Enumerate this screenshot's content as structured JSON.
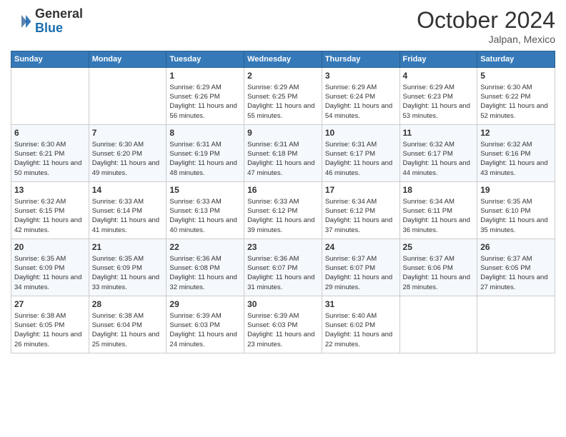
{
  "header": {
    "logo_line1": "General",
    "logo_line2": "Blue",
    "month_title": "October 2024",
    "location": "Jalpan, Mexico"
  },
  "days_of_week": [
    "Sunday",
    "Monday",
    "Tuesday",
    "Wednesday",
    "Thursday",
    "Friday",
    "Saturday"
  ],
  "weeks": [
    [
      {
        "day": "",
        "content": ""
      },
      {
        "day": "",
        "content": ""
      },
      {
        "day": "1",
        "content": "Sunrise: 6:29 AM\nSunset: 6:26 PM\nDaylight: 11 hours and 56 minutes."
      },
      {
        "day": "2",
        "content": "Sunrise: 6:29 AM\nSunset: 6:25 PM\nDaylight: 11 hours and 55 minutes."
      },
      {
        "day": "3",
        "content": "Sunrise: 6:29 AM\nSunset: 6:24 PM\nDaylight: 11 hours and 54 minutes."
      },
      {
        "day": "4",
        "content": "Sunrise: 6:29 AM\nSunset: 6:23 PM\nDaylight: 11 hours and 53 minutes."
      },
      {
        "day": "5",
        "content": "Sunrise: 6:30 AM\nSunset: 6:22 PM\nDaylight: 11 hours and 52 minutes."
      }
    ],
    [
      {
        "day": "6",
        "content": "Sunrise: 6:30 AM\nSunset: 6:21 PM\nDaylight: 11 hours and 50 minutes."
      },
      {
        "day": "7",
        "content": "Sunrise: 6:30 AM\nSunset: 6:20 PM\nDaylight: 11 hours and 49 minutes."
      },
      {
        "day": "8",
        "content": "Sunrise: 6:31 AM\nSunset: 6:19 PM\nDaylight: 11 hours and 48 minutes."
      },
      {
        "day": "9",
        "content": "Sunrise: 6:31 AM\nSunset: 6:18 PM\nDaylight: 11 hours and 47 minutes."
      },
      {
        "day": "10",
        "content": "Sunrise: 6:31 AM\nSunset: 6:17 PM\nDaylight: 11 hours and 46 minutes."
      },
      {
        "day": "11",
        "content": "Sunrise: 6:32 AM\nSunset: 6:17 PM\nDaylight: 11 hours and 44 minutes."
      },
      {
        "day": "12",
        "content": "Sunrise: 6:32 AM\nSunset: 6:16 PM\nDaylight: 11 hours and 43 minutes."
      }
    ],
    [
      {
        "day": "13",
        "content": "Sunrise: 6:32 AM\nSunset: 6:15 PM\nDaylight: 11 hours and 42 minutes."
      },
      {
        "day": "14",
        "content": "Sunrise: 6:33 AM\nSunset: 6:14 PM\nDaylight: 11 hours and 41 minutes."
      },
      {
        "day": "15",
        "content": "Sunrise: 6:33 AM\nSunset: 6:13 PM\nDaylight: 11 hours and 40 minutes."
      },
      {
        "day": "16",
        "content": "Sunrise: 6:33 AM\nSunset: 6:12 PM\nDaylight: 11 hours and 39 minutes."
      },
      {
        "day": "17",
        "content": "Sunrise: 6:34 AM\nSunset: 6:12 PM\nDaylight: 11 hours and 37 minutes."
      },
      {
        "day": "18",
        "content": "Sunrise: 6:34 AM\nSunset: 6:11 PM\nDaylight: 11 hours and 36 minutes."
      },
      {
        "day": "19",
        "content": "Sunrise: 6:35 AM\nSunset: 6:10 PM\nDaylight: 11 hours and 35 minutes."
      }
    ],
    [
      {
        "day": "20",
        "content": "Sunrise: 6:35 AM\nSunset: 6:09 PM\nDaylight: 11 hours and 34 minutes."
      },
      {
        "day": "21",
        "content": "Sunrise: 6:35 AM\nSunset: 6:09 PM\nDaylight: 11 hours and 33 minutes."
      },
      {
        "day": "22",
        "content": "Sunrise: 6:36 AM\nSunset: 6:08 PM\nDaylight: 11 hours and 32 minutes."
      },
      {
        "day": "23",
        "content": "Sunrise: 6:36 AM\nSunset: 6:07 PM\nDaylight: 11 hours and 31 minutes."
      },
      {
        "day": "24",
        "content": "Sunrise: 6:37 AM\nSunset: 6:07 PM\nDaylight: 11 hours and 29 minutes."
      },
      {
        "day": "25",
        "content": "Sunrise: 6:37 AM\nSunset: 6:06 PM\nDaylight: 11 hours and 28 minutes."
      },
      {
        "day": "26",
        "content": "Sunrise: 6:37 AM\nSunset: 6:05 PM\nDaylight: 11 hours and 27 minutes."
      }
    ],
    [
      {
        "day": "27",
        "content": "Sunrise: 6:38 AM\nSunset: 6:05 PM\nDaylight: 11 hours and 26 minutes."
      },
      {
        "day": "28",
        "content": "Sunrise: 6:38 AM\nSunset: 6:04 PM\nDaylight: 11 hours and 25 minutes."
      },
      {
        "day": "29",
        "content": "Sunrise: 6:39 AM\nSunset: 6:03 PM\nDaylight: 11 hours and 24 minutes."
      },
      {
        "day": "30",
        "content": "Sunrise: 6:39 AM\nSunset: 6:03 PM\nDaylight: 11 hours and 23 minutes."
      },
      {
        "day": "31",
        "content": "Sunrise: 6:40 AM\nSunset: 6:02 PM\nDaylight: 11 hours and 22 minutes."
      },
      {
        "day": "",
        "content": ""
      },
      {
        "day": "",
        "content": ""
      }
    ]
  ]
}
